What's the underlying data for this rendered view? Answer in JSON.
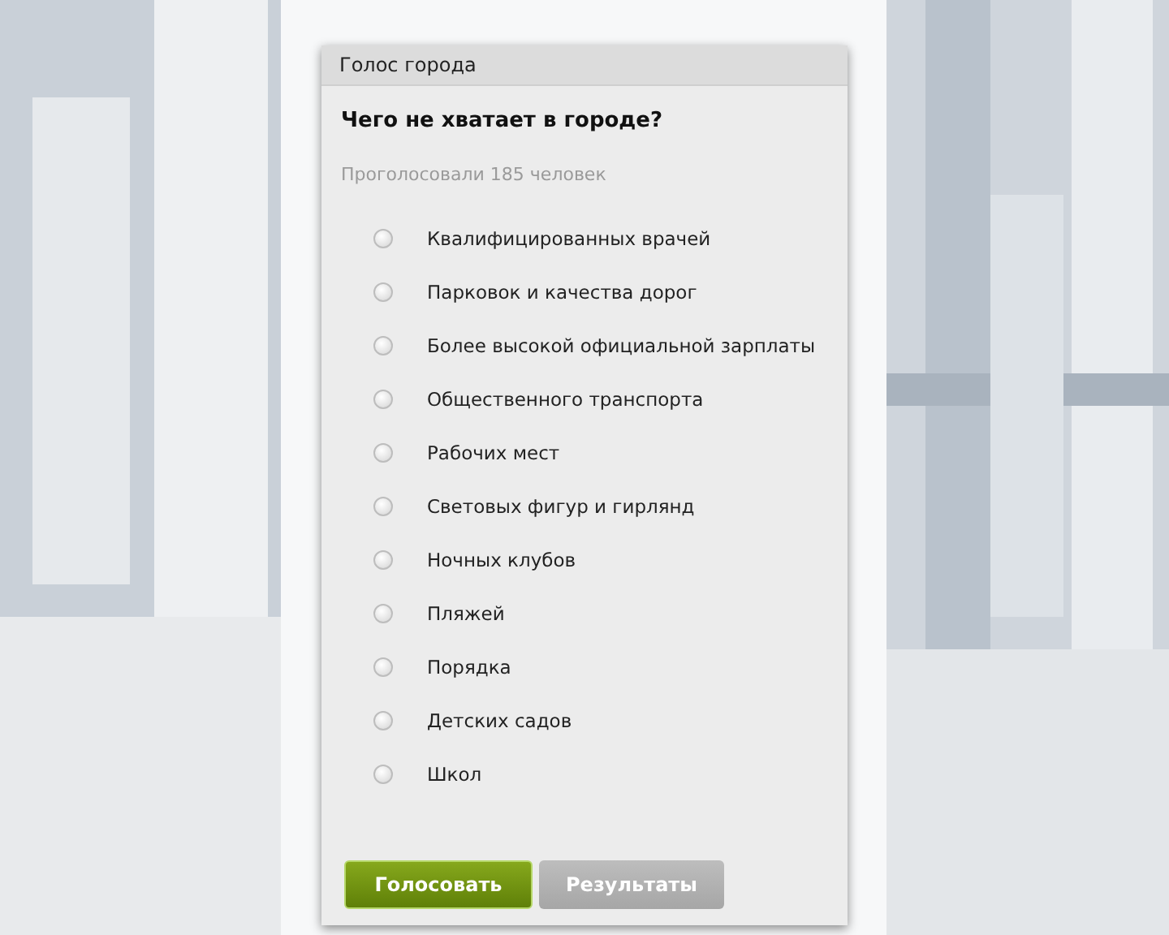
{
  "poll": {
    "header": "Голос города",
    "question": "Чего не хватает в городе?",
    "votes": "Проголосовали 185 человек",
    "options": [
      {
        "label": "Квалифицированных врачей",
        "selected": false
      },
      {
        "label": "Парковок и качества дорог",
        "selected": false
      },
      {
        "label": "Более высокой официальной зарплаты",
        "selected": false
      },
      {
        "label": "Общественного транспорта",
        "selected": false
      },
      {
        "label": "Рабочих мест",
        "selected": false
      },
      {
        "label": "Световых фигур и гирлянд",
        "selected": false
      },
      {
        "label": "Ночных клубов",
        "selected": false
      },
      {
        "label": "Пляжей",
        "selected": false
      },
      {
        "label": "Порядка",
        "selected": false
      },
      {
        "label": "Детских садов",
        "selected": false
      },
      {
        "label": "Школ",
        "selected": false
      }
    ],
    "buttons": [
      {
        "label": "Голосовать",
        "kind": "primary"
      },
      {
        "label": "Результаты",
        "kind": "secondary"
      }
    ]
  }
}
